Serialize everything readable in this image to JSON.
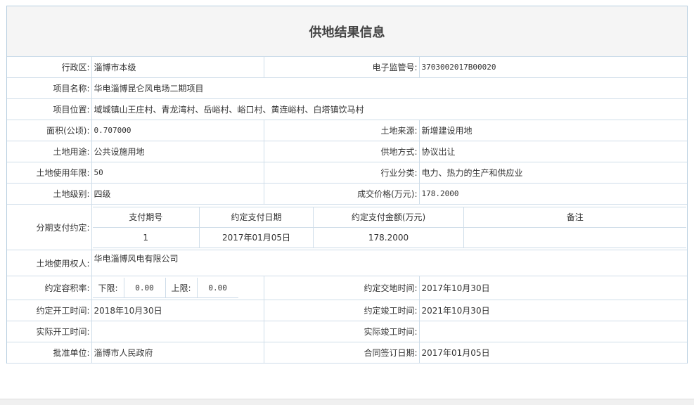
{
  "title": "供地结果信息",
  "labels": {
    "district": "行政区:",
    "supervision_no": "电子监管号:",
    "project_name": "项目名称:",
    "project_location": "项目位置:",
    "area": "面积(公顷):",
    "land_source": "土地来源:",
    "land_use": "土地用途:",
    "supply_method": "供地方式:",
    "use_years": "土地使用年限:",
    "industry": "行业分类:",
    "land_grade": "土地级别:",
    "price": "成交价格(万元):",
    "installment": "分期支付约定:",
    "holder": "土地使用权人:",
    "far": "约定容积率:",
    "delivery_date": "约定交地时间:",
    "start_date": "约定开工时间:",
    "completion_date": "约定竣工时间:",
    "actual_start": "实际开工时间:",
    "actual_completion": "实际竣工时间:",
    "approval_unit": "批准单位:",
    "contract_date": "合同签订日期:"
  },
  "values": {
    "district": "淄博市本级",
    "supervision_no": "3703002017B00020",
    "project_name": "华电淄博昆仑风电场二期项目",
    "project_location": "域城镇山王庄村、青龙湾村、岳峪村、峪口村、黄连峪村、白塔镇饮马村",
    "area": "0.707000",
    "land_source": "新增建设用地",
    "land_use": "公共设施用地",
    "supply_method": "协议出让",
    "use_years": "50",
    "industry": "电力、热力的生产和供应业",
    "land_grade": "四级",
    "price": "178.2000",
    "holder": "华电淄博风电有限公司",
    "delivery_date": "2017年10月30日",
    "start_date": "2018年10月30日",
    "completion_date": "2021年10月30日",
    "actual_start": "",
    "actual_completion": "",
    "approval_unit": "淄博市人民政府",
    "contract_date": "2017年01月05日"
  },
  "installments": {
    "headers": [
      "支付期号",
      "约定支付日期",
      "约定支付金额(万元)",
      "备注"
    ],
    "rows": [
      {
        "period": "1",
        "date": "2017年01月05日",
        "amount": "178.2000",
        "note": ""
      }
    ]
  },
  "far": {
    "lower_label": "下限:",
    "lower_value": "0.00",
    "upper_label": "上限:",
    "upper_value": "0.00"
  },
  "colors": {
    "border": "#cfdde9",
    "title_bg": "#f5f5f5"
  }
}
